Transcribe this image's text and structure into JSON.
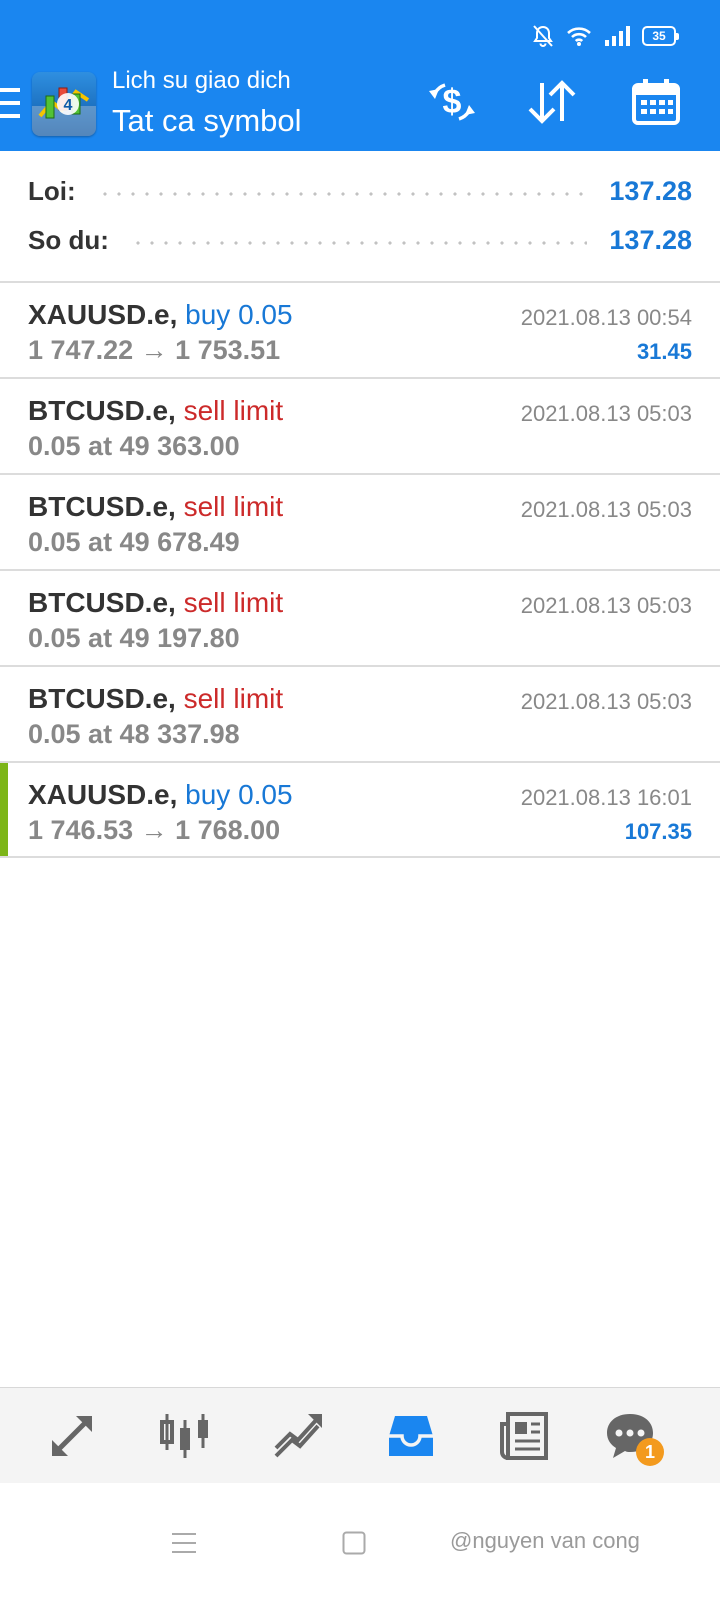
{
  "status_bar": {
    "battery": "35",
    "icons": [
      "bell-off-icon",
      "wifi-icon",
      "signal-icon",
      "battery-icon"
    ]
  },
  "header": {
    "subtitle": "Lich su giao dich",
    "title": "Tat ca symbol",
    "actions": [
      "currency-exchange-icon",
      "sort-icon",
      "calendar-icon"
    ]
  },
  "summary": {
    "profit_label": "Loi:",
    "profit_value": "137.28",
    "balance_label": "So du:",
    "balance_value": "137.28"
  },
  "deals": [
    {
      "symbol": "XAUUSD.e,",
      "type": "buy 0.05",
      "kind": "buy",
      "detail": "1 747.22 → 1 753.51",
      "time": "2021.08.13 00:54",
      "profit": "31.45"
    },
    {
      "symbol": "BTCUSD.e,",
      "type": "sell limit",
      "kind": "sell",
      "detail": "0.05 at 49 363.00",
      "time": "2021.08.13 05:03",
      "profit": ""
    },
    {
      "symbol": "BTCUSD.e,",
      "type": "sell limit",
      "kind": "sell",
      "detail": "0.05 at 49 678.49",
      "time": "2021.08.13 05:03",
      "profit": ""
    },
    {
      "symbol": "BTCUSD.e,",
      "type": "sell limit",
      "kind": "sell",
      "detail": "0.05 at 49 197.80",
      "time": "2021.08.13 05:03",
      "profit": ""
    },
    {
      "symbol": "BTCUSD.e,",
      "type": "sell limit",
      "kind": "sell",
      "detail": "0.05 at 48 337.98",
      "time": "2021.08.13 05:03",
      "profit": ""
    },
    {
      "symbol": "XAUUSD.e,",
      "type": "buy 0.05",
      "kind": "buy",
      "detail": "1 746.53 → 1 768.00",
      "time": "2021.08.13 16:01",
      "profit": "107.35"
    }
  ],
  "bottom_nav": {
    "items": [
      "quotes-icon",
      "chart-icon",
      "trade-icon",
      "history-icon",
      "news-icon",
      "chat-icon"
    ],
    "active": "history-icon",
    "chat_badge": "1"
  },
  "watermark": "@nguyen van cong",
  "colors": {
    "app_bar": "#1a86f0",
    "accent_blue": "#1878d6",
    "sell_red": "#cc2a2a",
    "marker_green": "#7cb518",
    "badge_orange": "#f39a1e"
  }
}
